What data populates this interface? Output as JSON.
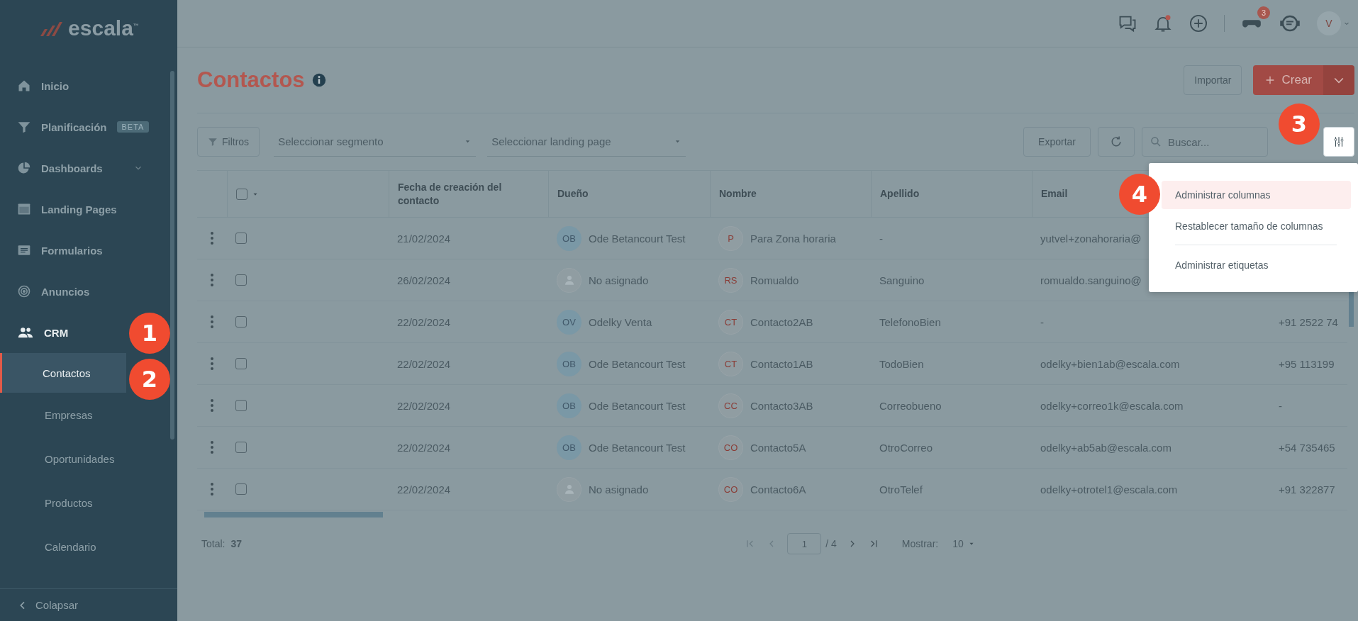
{
  "brand": {
    "name": "escala",
    "trademark": "™"
  },
  "topbar": {
    "game_badge": "3",
    "avatar": "V"
  },
  "sidebar": {
    "items": [
      {
        "label": "Inicio",
        "selected": false
      },
      {
        "label": "Planificación",
        "badge": "BETA",
        "selected": false
      },
      {
        "label": "Dashboards",
        "expanded": false,
        "selected": false
      },
      {
        "label": "Landing Pages",
        "selected": false
      },
      {
        "label": "Formularios",
        "selected": false
      },
      {
        "label": "Anuncios",
        "selected": false
      },
      {
        "label": "CRM",
        "selected": true,
        "children": [
          {
            "label": "Contactos",
            "selected": true
          },
          {
            "label": "Empresas",
            "selected": false
          },
          {
            "label": "Oportunidades",
            "selected": false
          },
          {
            "label": "Productos",
            "selected": false
          },
          {
            "label": "Calendario",
            "selected": false
          }
        ]
      }
    ],
    "collapse": "Colapsar"
  },
  "page": {
    "title": "Contactos",
    "import_button": "Importar",
    "create_button": "Crear"
  },
  "toolbar": {
    "filters_button": "Filtros",
    "segment_placeholder": "Seleccionar segmento",
    "landing_placeholder": "Seleccionar landing page",
    "export_button": "Exportar",
    "search_placeholder": "Buscar..."
  },
  "table": {
    "select_all_checked": false,
    "columns": [
      "Fecha de creación del contacto",
      "Dueño",
      "Nombre",
      "Apellido",
      "Email"
    ],
    "rows": [
      {
        "checked": false,
        "date": "21/02/2024",
        "owner": {
          "initials": "OB",
          "name": "Ode Betancourt Test"
        },
        "contact": {
          "initials": "P",
          "name": "Para Zona horaria"
        },
        "surname": "-",
        "email": "yutvel+zonahoraria@"
      },
      {
        "checked": false,
        "date": "26/02/2024",
        "owner": {
          "name": "No asignado"
        },
        "contact": {
          "initials": "RS",
          "name": "Romualdo"
        },
        "surname": "Sanguino",
        "email": "romualdo.sanguino@"
      },
      {
        "checked": false,
        "date": "22/02/2024",
        "owner": {
          "initials": "OV",
          "name": "Odelky Venta"
        },
        "contact": {
          "initials": "CT",
          "name": "Contacto2AB"
        },
        "surname": "TelefonoBien",
        "email": "-",
        "column_7": "+91 2522 74"
      },
      {
        "checked": false,
        "date": "22/02/2024",
        "owner": {
          "initials": "OB",
          "name": "Ode Betancourt Test"
        },
        "contact": {
          "initials": "CT",
          "name": "Contacto1AB"
        },
        "surname": "TodoBien",
        "email": "odelky+bien1ab@escala.com",
        "column_7": "+95 113199"
      },
      {
        "checked": false,
        "date": "22/02/2024",
        "owner": {
          "initials": "OB",
          "name": "Ode Betancourt Test"
        },
        "contact": {
          "initials": "CC",
          "name": "Contacto3AB"
        },
        "surname": "Correobueno",
        "email": "odelky+correo1k@escala.com",
        "column_7": "-"
      },
      {
        "checked": false,
        "date": "22/02/2024",
        "owner": {
          "initials": "OB",
          "name": "Ode Betancourt Test"
        },
        "contact": {
          "initials": "CO",
          "name": "Contacto5A"
        },
        "surname": "OtroCorreo",
        "email": "odelky+ab5ab@escala.com",
        "column_7": "+54 735465"
      },
      {
        "checked": false,
        "date": "22/02/2024",
        "owner": {
          "name": "No asignado"
        },
        "contact": {
          "initials": "CO",
          "name": "Contacto6A"
        },
        "surname": "OtroTelef",
        "email": "odelky+otrotel1@escala.com",
        "column_7": "+91 322877"
      }
    ]
  },
  "footer": {
    "total_label": "Total:",
    "total": "37",
    "page": "1",
    "pages": "/ 4",
    "show_label": "Mostrar:",
    "page_size": "10"
  },
  "column_menu": {
    "groups": [
      [
        {
          "label": "Administrar columnas",
          "selected": true
        },
        {
          "label": "Restablecer tamaño de columnas",
          "selected": false
        }
      ],
      [
        {
          "label": "Administrar etiquetas",
          "selected": false
        }
      ]
    ]
  },
  "callouts": [
    "1",
    "2",
    "3",
    "4"
  ]
}
